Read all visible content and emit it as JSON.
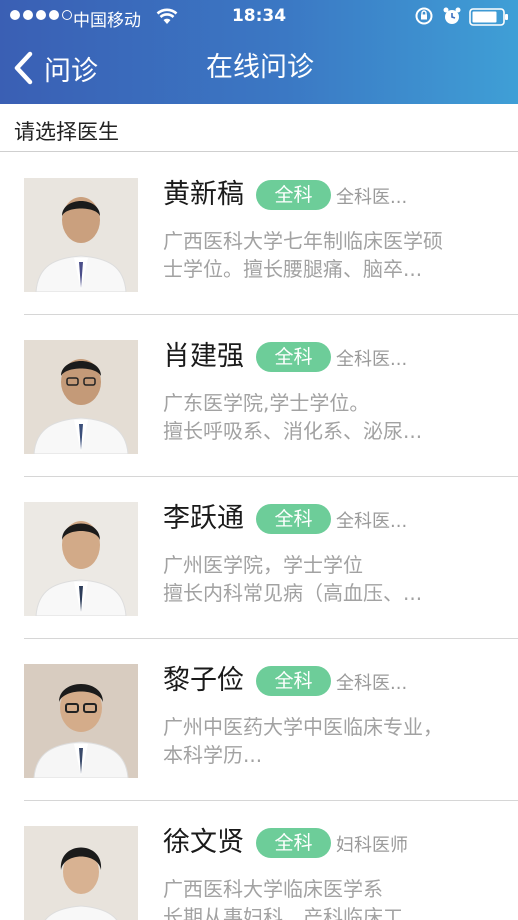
{
  "status_bar": {
    "carrier": "中国移动",
    "time": "18:34"
  },
  "nav": {
    "back_label": "问诊",
    "title": "在线问诊"
  },
  "section": {
    "label": "请选择医生"
  },
  "doctors": [
    {
      "name": "黄新稿",
      "dept": "全科",
      "title": "全科医...",
      "desc_line1": "广西医科大学七年制临床医学硕",
      "desc_line2": "士学位。擅长腰腿痛、脑卒..."
    },
    {
      "name": "肖建强",
      "dept": "全科",
      "title": "全科医...",
      "desc_line1": "广东医学院,学士学位。",
      "desc_line2": "擅长呼吸系、消化系、泌尿..."
    },
    {
      "name": "李跃通",
      "dept": "全科",
      "title": "全科医...",
      "desc_line1": "广州医学院，学士学位",
      "desc_line2": "擅长内科常见病（高血压、..."
    },
    {
      "name": "黎子俭",
      "dept": "全科",
      "title": "全科医...",
      "desc_line1": "广州中医药大学中医临床专业，",
      "desc_line2": "本科学历..."
    },
    {
      "name": "徐文贤",
      "dept": "全科",
      "title": "妇科医师",
      "desc_line1": "广西医科大学临床医学系",
      "desc_line2": "长期从事妇科、产科临床工"
    }
  ],
  "colors": {
    "header_start": "#3a5fb4",
    "header_end": "#3f9fd6",
    "tag_green": "#6dcd99"
  }
}
